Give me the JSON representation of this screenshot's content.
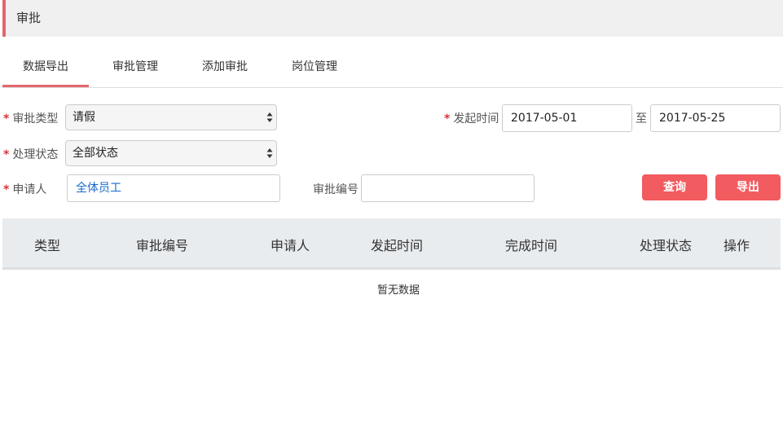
{
  "header": {
    "title": "审批"
  },
  "tabs": [
    {
      "label": "数据导出"
    },
    {
      "label": "审批管理"
    },
    {
      "label": "添加审批"
    },
    {
      "label": "岗位管理"
    }
  ],
  "form": {
    "required_mark": "*",
    "approval_type": {
      "label": "审批类型",
      "value": "请假"
    },
    "status": {
      "label": "处理状态",
      "value": "全部状态"
    },
    "applicant": {
      "label": "申请人",
      "value": "全体员工"
    },
    "approval_no": {
      "label": "审批编号",
      "value": ""
    },
    "start_time": {
      "label": "发起时间",
      "from": "2017-05-01",
      "separator": "至",
      "to": "2017-05-25"
    }
  },
  "buttons": {
    "query": "查询",
    "export": "导出"
  },
  "table": {
    "columns": [
      "类型",
      "审批编号",
      "申请人",
      "发起时间",
      "完成时间",
      "处理状态",
      "操作"
    ],
    "empty_text": "暂无数据"
  },
  "colors": {
    "accent": "#e4676a",
    "button": "#f25b5f",
    "required": "#d9343b",
    "link": "#1a6bc7"
  }
}
